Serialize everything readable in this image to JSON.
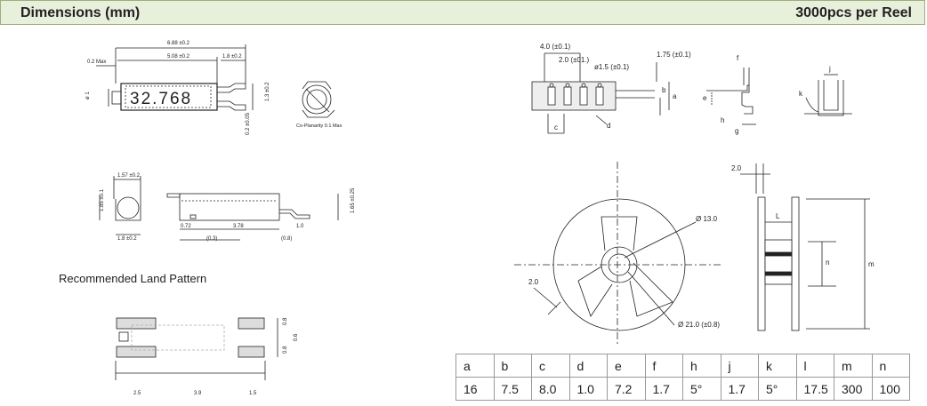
{
  "header": {
    "title": "Dimensions (mm)",
    "right": "3000pcs per Reel"
  },
  "land_pattern_label": "Recommended Land Pattern",
  "crystal": {
    "marking": "32.768",
    "dims": {
      "total": "6.88 ±0.2",
      "body": "5.08 ±0.2",
      "lead": "1.8 ±0.2",
      "gap": "0.2 Max",
      "dia": "ø 1",
      "height": "1.3 ±0.2",
      "lead_thk": "0.2 ±0.05",
      "coplanarity": "Co-Planarity 0.1 Max"
    }
  },
  "side_views": {
    "top_width": "1.57 ±0.2",
    "left_height": "1.85 ±0.1",
    "bottom_width": "1.8 ±0.2",
    "right_height": "1.65 ±0.25",
    "d1": "0.72",
    "d2": "3.78",
    "d3": "1.0",
    "d4": "(0.3)",
    "d5": "(0.8)"
  },
  "land_pattern": {
    "w1": "2.5",
    "w2": "3.9",
    "w3": "1.5",
    "h1": "0.8",
    "h2": "0.6",
    "h3": "0.8"
  },
  "tape": {
    "pitch": "4.0 (±0.1)",
    "hole_pitch": "2.0 (±01.)",
    "hole_dia": "ø1.5 (±0.1)",
    "edge": "1.75 (±0.1)",
    "letters": [
      "a",
      "b",
      "c",
      "d",
      "e",
      "f",
      "g",
      "h",
      "j",
      "k"
    ]
  },
  "reel": {
    "hub_dia": "Ø 13.0",
    "reel_dia": "Ø 21.0 (±0.8)",
    "slot": "2.0",
    "side_gap": "2.0",
    "letters": [
      "L",
      "n",
      "m"
    ]
  },
  "table": {
    "headers": [
      "a",
      "b",
      "c",
      "d",
      "e",
      "f",
      "h",
      "j",
      "k",
      "l",
      "m",
      "n"
    ],
    "values": [
      "16",
      "7.5",
      "8.0",
      "1.0",
      "7.2",
      "1.7",
      "5°",
      "1.7",
      "5°",
      "17.5",
      "300",
      "100"
    ]
  }
}
